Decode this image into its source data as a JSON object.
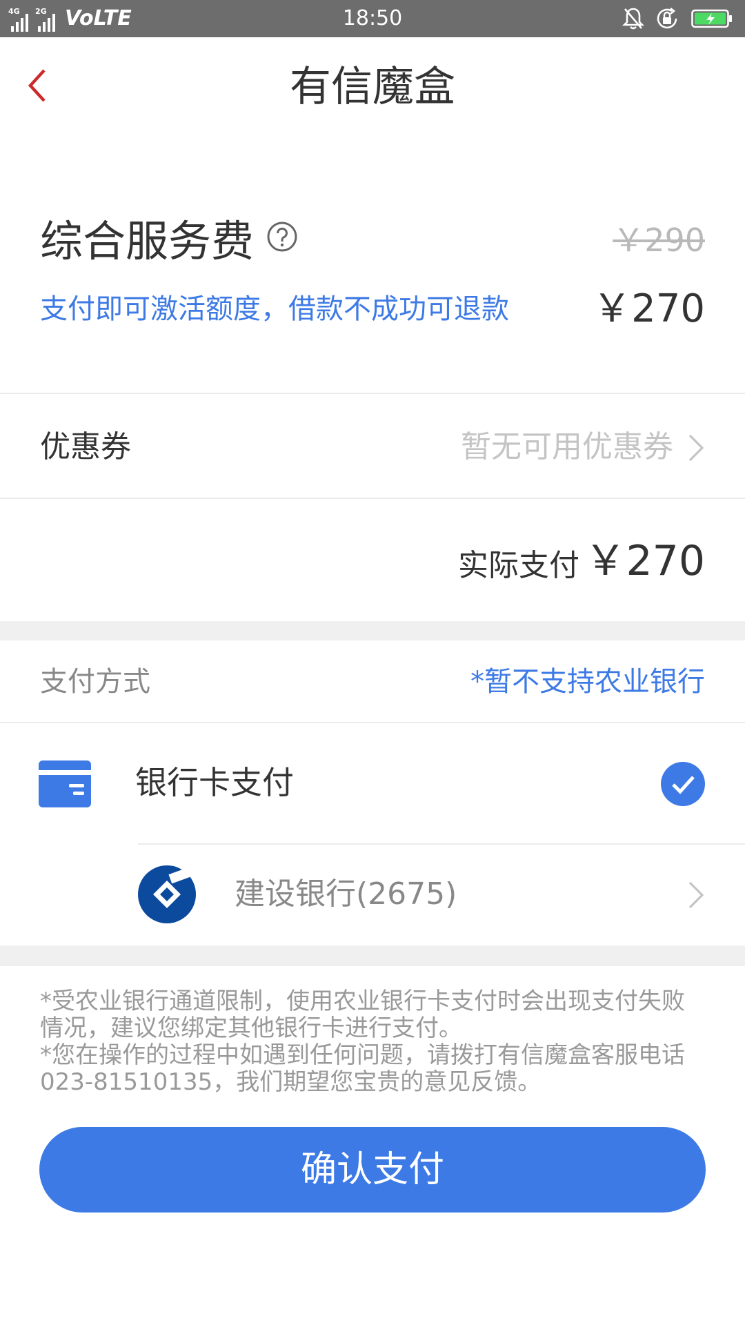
{
  "status_bar": {
    "network_4g": "4G",
    "network_2g": "2G",
    "volte": "VoLTE",
    "time": "18:50",
    "icons": [
      "bell-off-icon",
      "rotation-lock-icon",
      "battery-charging-icon"
    ]
  },
  "nav": {
    "title": "有信魔盒",
    "back_icon": "chevron-left-icon"
  },
  "fee": {
    "title": "综合服务费",
    "original_price": "￥290",
    "description": "支付即可激活额度，借款不成功可退款",
    "price": "￥270"
  },
  "coupon": {
    "label": "优惠券",
    "value": "暂无可用优惠券"
  },
  "actual_payment": {
    "label": "实际支付",
    "amount": "￥270"
  },
  "payment_method": {
    "label": "支付方式",
    "note": "*暂不支持农业银行",
    "option_label": "银行卡支付",
    "selected": true,
    "bank": "建设银行(2675)"
  },
  "notes": [
    "*受农业银行通道限制，使用农业银行卡支付时会出现支付失败情况，建议您绑定其他银行卡进行支付。",
    "*您在操作的过程中如遇到任何问题，请拨打有信魔盒客服电话023-81510135，我们期望您宝贵的意见反馈。"
  ],
  "confirm_button": "确认支付",
  "colors": {
    "accent": "#3d7ae6",
    "back_arrow": "#cc2a2a",
    "status_bar": "#6d6d6d",
    "battery": "#4cd964",
    "bank_logo": "#0b4a9c"
  }
}
